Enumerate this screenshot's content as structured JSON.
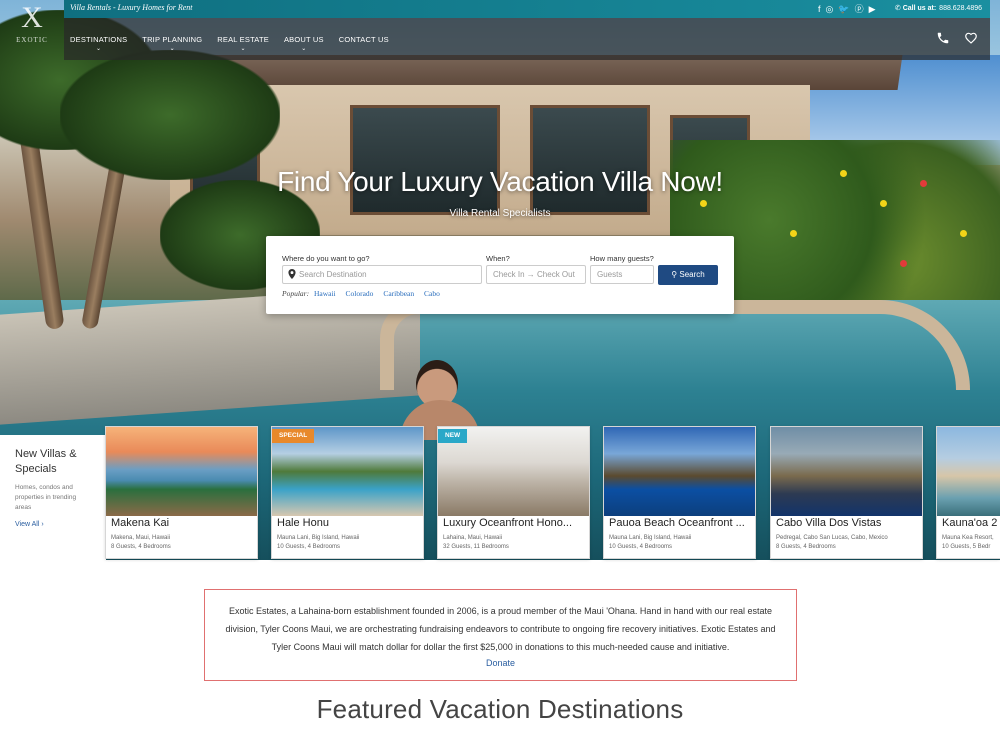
{
  "brand": {
    "tagline": "Villa Rentals - Luxury Homes for Rent",
    "call_label": "Call us at:",
    "phone": "888.628.4896"
  },
  "social_icons": [
    "facebook-icon",
    "instagram-icon",
    "twitter-icon",
    "pinterest-icon",
    "youtube-icon"
  ],
  "nav": {
    "items": [
      {
        "label": "DESTINATIONS",
        "has_dropdown": true
      },
      {
        "label": "TRIP PLANNING",
        "has_dropdown": true
      },
      {
        "label": "REAL ESTATE",
        "has_dropdown": true
      },
      {
        "label": "ABOUT US",
        "has_dropdown": true
      },
      {
        "label": "CONTACT US",
        "has_dropdown": false
      }
    ]
  },
  "hero": {
    "headline": "Find Your Luxury Vacation Villa Now!",
    "subhead": "Villa Rental Specialists"
  },
  "search": {
    "where_label": "Where do you want to go?",
    "where_placeholder": "Search Destination",
    "when_label": "When?",
    "when_placeholder": "Check In → Check Out",
    "guests_label": "How many guests?",
    "guests_placeholder": "Guests",
    "button_label": "Search",
    "popular_label": "Popular:",
    "popular": [
      "Hawaii",
      "Colorado",
      "Caribbean",
      "Cabo"
    ]
  },
  "new_villas": {
    "title": "New Villas & Specials",
    "description": "Homes, condos and properties in trending areas",
    "view_all": "View All"
  },
  "cards": [
    {
      "title": "Makena Kai",
      "location": "Makena, Maui, Hawaii",
      "details": "8 Guests, 4 Bedrooms",
      "badge": ""
    },
    {
      "title": "Hale Honu",
      "location": "Mauna Lani, Big Island, Hawaii",
      "details": "10 Guests, 4 Bedrooms",
      "badge": "SPECIAL",
      "badge_color": "#e8892b"
    },
    {
      "title": "Luxury Oceanfront Hono...",
      "location": "Lahaina, Maui, Hawaii",
      "details": "32 Guests, 11 Bedrooms",
      "badge": "NEW",
      "badge_color": "#2aa8c8"
    },
    {
      "title": "Pauoa Beach Oceanfront ...",
      "location": "Mauna Lani, Big Island, Hawaii",
      "details": "10 Guests, 4 Bedrooms",
      "badge": ""
    },
    {
      "title": "Cabo Villa Dos Vistas",
      "location": "Pedregal, Cabo San Lucas, Cabo, Mexico",
      "details": "8 Guests, 4 Bedrooms",
      "badge": ""
    },
    {
      "title": "Kauna'oa 2",
      "location": "Mauna Kea Resort,",
      "details": "10 Guests, 5 Bedr",
      "badge": ""
    }
  ],
  "notice": {
    "text": "Exotic Estates, a Lahaina-born establishment founded in 2006, is a proud member of the Maui 'Ohana. Hand in hand with our real estate division, Tyler Coons Maui, we are orchestrating fundraising endeavors to contribute to ongoing fire recovery initiatives. Exotic Estates and Tyler Coons Maui will match dollar for dollar the first $25,000 in donations to this much-needed cause and initiative.",
    "donate": "Donate"
  },
  "featured_heading": "Featured Vacation Destinations",
  "colors": {
    "topbar": "#0f6f80",
    "search_button": "#1f4a82",
    "link": "#2a6ebd",
    "notice_border": "#e07070"
  }
}
